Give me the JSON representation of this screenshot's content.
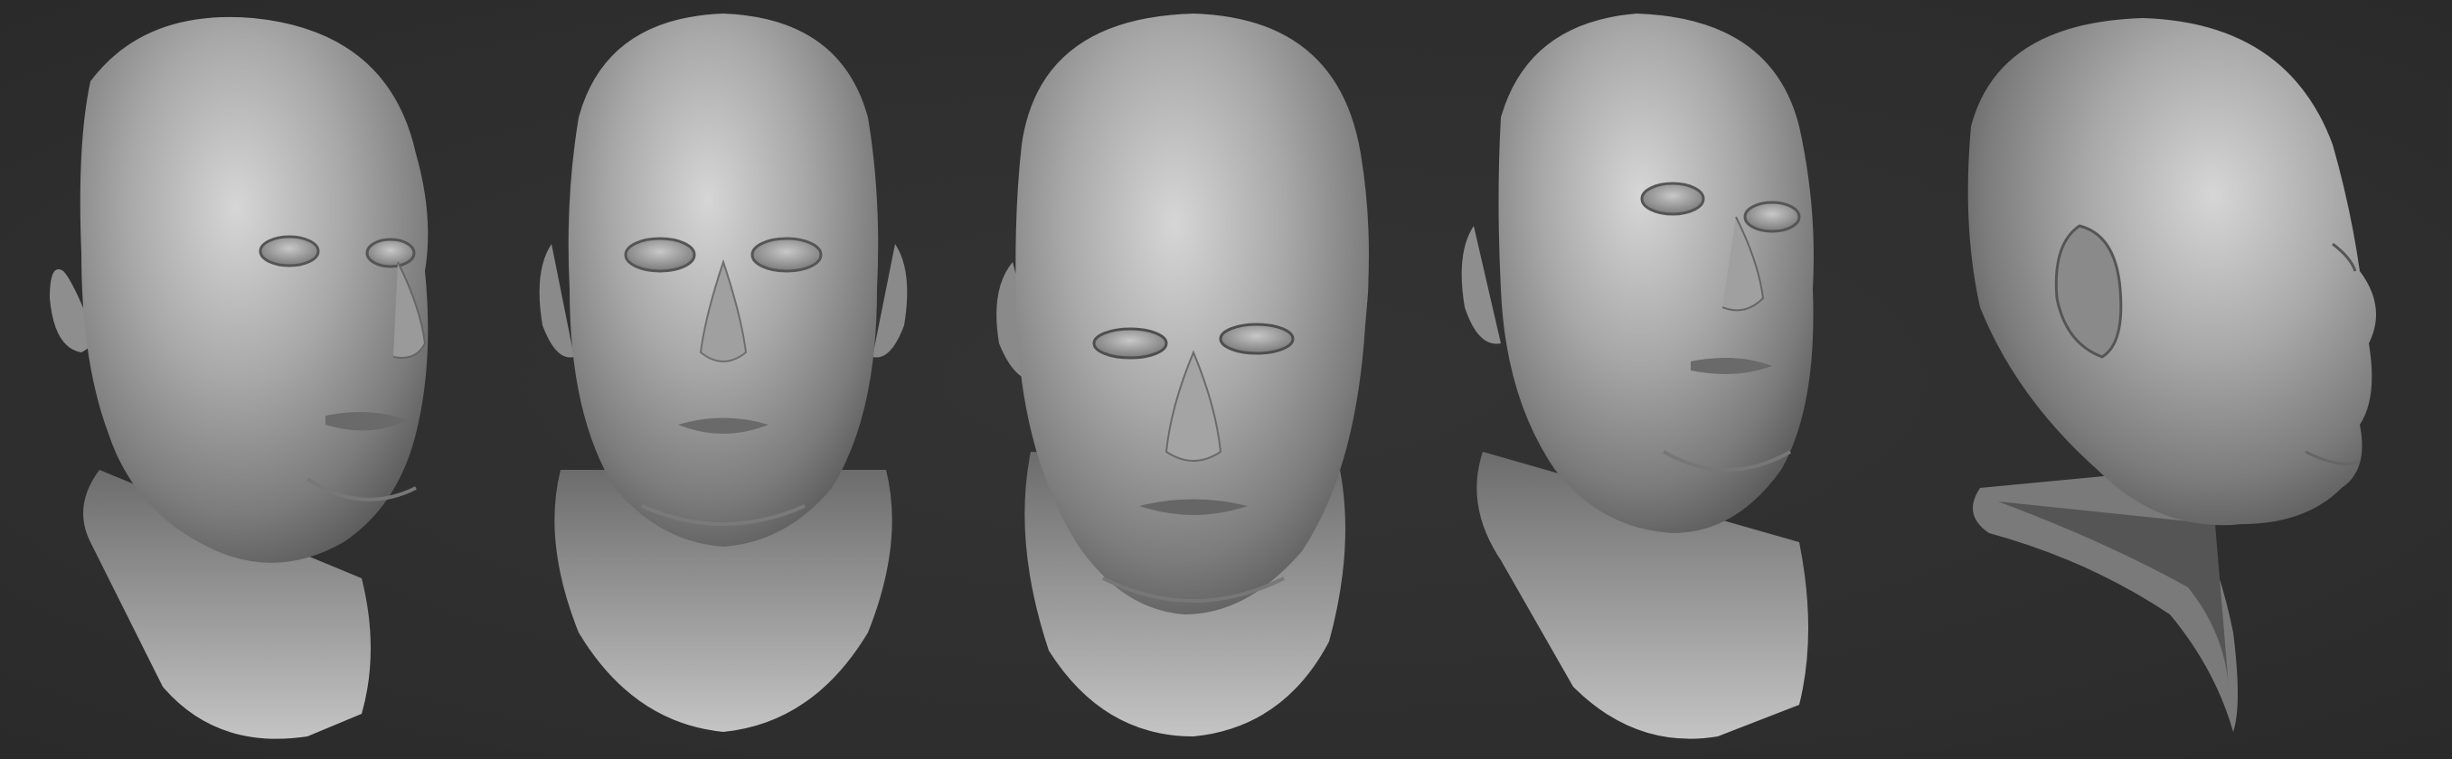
{
  "scene": {
    "background_color": "#2f2f2f",
    "material_color": "#a4a4a4",
    "highlight_color": "#d2d2d2",
    "shadow_color": "#4a4a4a",
    "views": [
      {
        "id": "three-quarter-right",
        "icon": "head-three-quarter-right"
      },
      {
        "id": "front",
        "icon": "head-front"
      },
      {
        "id": "front-low-angle",
        "icon": "head-front-tilted"
      },
      {
        "id": "three-quarter-right-alt",
        "icon": "head-three-quarter-right"
      },
      {
        "id": "profile-right",
        "icon": "head-profile-right"
      }
    ]
  }
}
